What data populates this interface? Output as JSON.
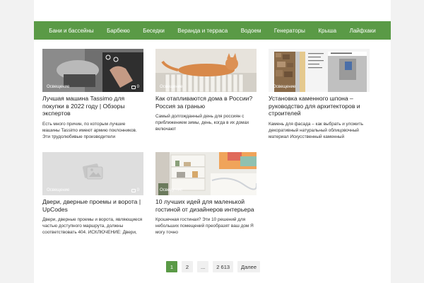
{
  "nav": {
    "items": [
      "Бани и бассейны",
      "Барбекю",
      "Беседки",
      "Веранда и терраса",
      "Водоем",
      "Генераторы",
      "Крыша",
      "Лайфхаки"
    ]
  },
  "cards": [
    {
      "tag": "Освещение",
      "comments": "0",
      "title": "Лучшая машина Tassimo для покупки в 2022 году | Обзоры экспертов",
      "excerpt": "Есть много причин, по которым лучшие машины Tassimo имеют армию поклонников. Эти трудолюбивые производители"
    },
    {
      "tag": "Освещение",
      "comments": "0",
      "title": "Как отапливаются дома в России? Россия за гранью",
      "excerpt": "Самый долгожданный день для россиян с приближением зимы, день, когда в их домах включают"
    },
    {
      "tag": "Освещение",
      "comments": "0",
      "title": "Установка каменного шпона – руководство для архитекторов и строителей",
      "excerpt": "Камень для фасада – как выбрать и уложить декоративный натуральный облицовочный материал Искусственный каменный"
    },
    {
      "tag": "Освещение",
      "comments": "0",
      "title": "Двери, дверные проемы и ворота | UpCodes",
      "excerpt": "Двери, дверные проемы и ворота, являющиеся частью доступного маршрута, должны соответствовать 404. ИСКЛЮЧЕНИЕ: Двери,"
    },
    {
      "tag": "Освещение",
      "comments": "0",
      "title": "10 лучших идей для маленькой гостиной от дизайнеров интерьера",
      "excerpt": "Крошечная гостиная? Эти 10 решений для небольших помещений преобразят ваш дом Я могу точно"
    }
  ],
  "pagination": {
    "p1": "1",
    "p2": "2",
    "dots": "...",
    "last": "2 613",
    "next": "Далее"
  },
  "colors": {
    "accent": "#5a9a46"
  }
}
